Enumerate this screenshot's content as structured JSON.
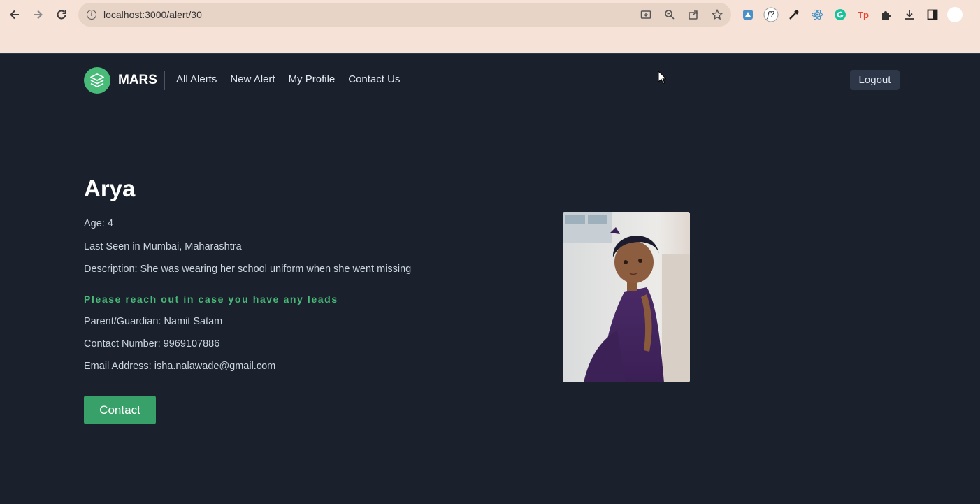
{
  "browser": {
    "url": "localhost:3000/alert/30"
  },
  "header": {
    "brand": "MARS",
    "nav": [
      "All Alerts",
      "New Alert",
      "My Profile",
      "Contact Us"
    ],
    "logout_label": "Logout"
  },
  "alert": {
    "name": "Arya",
    "age": "Age: 4",
    "last_seen": "Last Seen in Mumbai, Maharashtra",
    "description": "Description: She was wearing her school uniform when she went missing",
    "leads_prompt": "Please reach out in case you have any leads",
    "guardian": "Parent/Guardian: Namit Satam",
    "contact_number": "Contact Number: 9969107886",
    "email": "Email Address: isha.nalawade@gmail.com",
    "contact_button": "Contact"
  },
  "colors": {
    "background": "#1a202c",
    "accent": "#48bb78",
    "button": "#38a169"
  }
}
